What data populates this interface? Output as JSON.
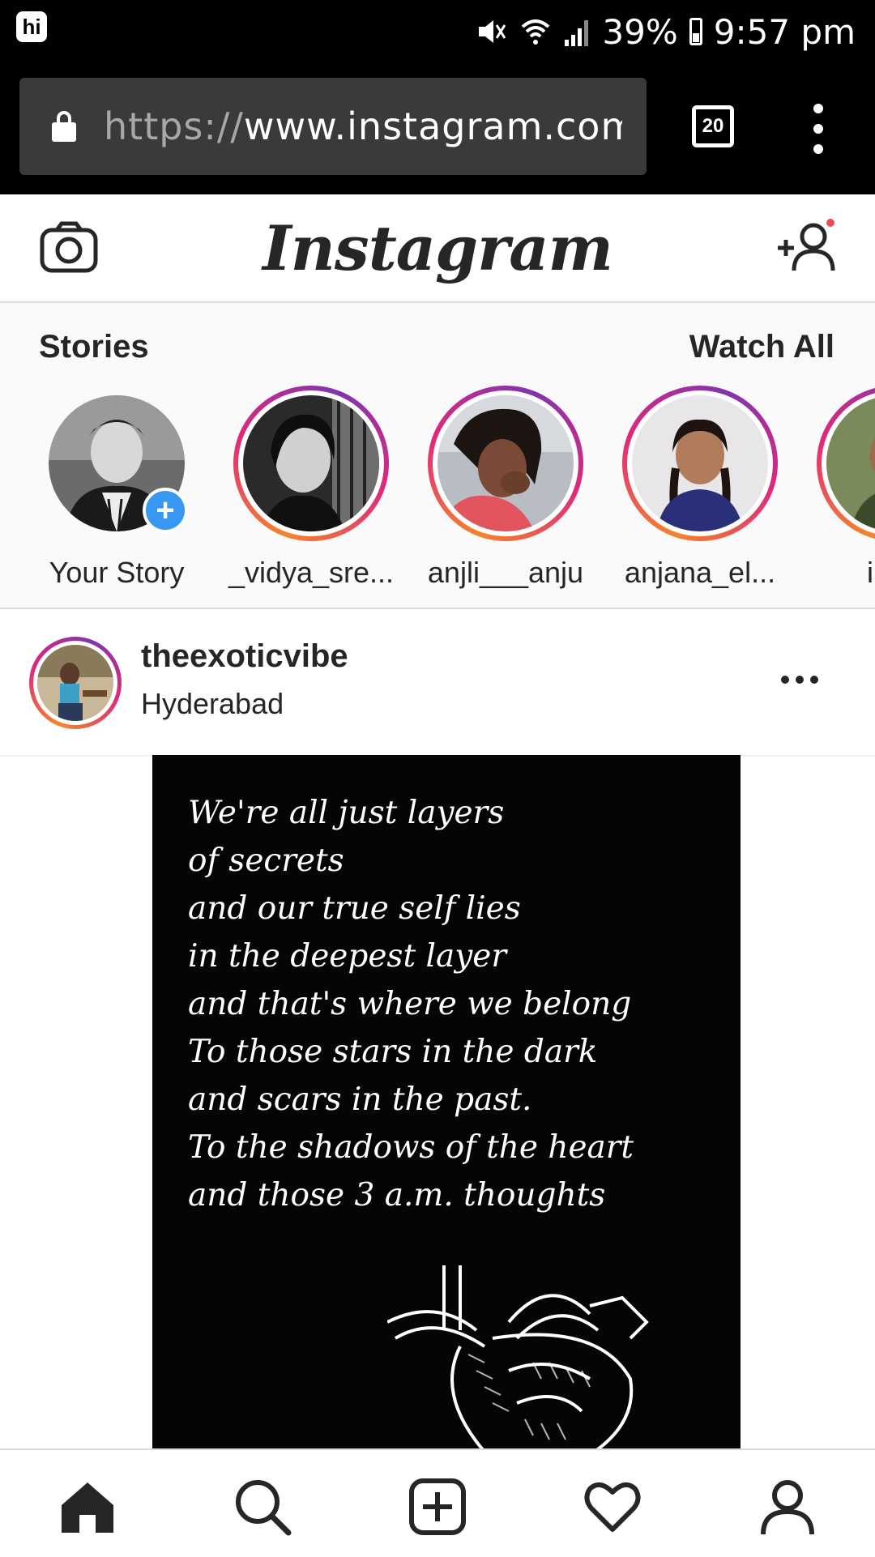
{
  "status_bar": {
    "app_badge": "hi",
    "battery": "39%",
    "time": "9:57 pm"
  },
  "browser": {
    "url_scheme": "https://",
    "url_host": "www.instagram.com/",
    "tab_count": "20"
  },
  "header": {
    "logo_text": "Instagram",
    "has_notification": true
  },
  "stories": {
    "title": "Stories",
    "watch_all": "Watch All",
    "items": [
      {
        "label": "Your Story"
      },
      {
        "label": "_vidya_sre..."
      },
      {
        "label": "anjli___anju"
      },
      {
        "label": "anjana_el..."
      },
      {
        "label": "indh"
      }
    ]
  },
  "post": {
    "username": "theexoticvibe",
    "location": "Hyderabad",
    "poem_lines": [
      "We're all just layers",
      "of secrets",
      "and our true self lies",
      "in the deepest layer",
      "and that's where we belong",
      "To those stars in the dark",
      "and scars in the past.",
      "To the shadows of the heart",
      "and those 3 a.m. thoughts"
    ]
  },
  "nav": {
    "items": [
      "home-icon",
      "search-icon",
      "new-post-icon",
      "activity-heart-icon",
      "profile-icon"
    ]
  },
  "colors": {
    "story_ring": "#dd2a7b",
    "add_badge": "#3897f0",
    "notification_dot": "#ed4956"
  }
}
